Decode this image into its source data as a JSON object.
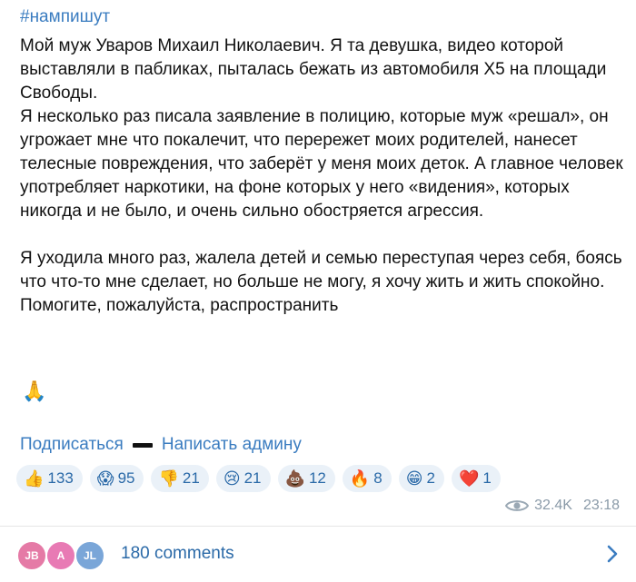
{
  "post": {
    "hashtag": "#нампишут",
    "paragraph1": "Мой муж Уваров Михаил Николаевич. Я та девушка, видео которой выставляли в пабликах, пыталась бежать из автомобиля Х5 на площади Свободы.",
    "paragraph2": "Я несколько раз писала заявление в полицию, которые муж «решал», он угрожает мне что покалечит, что перережет моих родителей, нанесет телесные повреждения, что заберёт у меня моих деток. А главное человек употребляет наркотики, на фоне которых у него «видения», которых никогда и не было, и очень сильно обостряется агрессия.",
    "paragraph3": "Я уходила много раз, жалела детей и семью переступая через себя, боясь что что-то мне сделает, но больше не могу, я хочу жить и жить спокойно. Помогите, пожалуйста, распространить",
    "pray_emoji": "🙏"
  },
  "links": {
    "subscribe": "Подписаться",
    "write_admin": "Написать админу"
  },
  "reactions": [
    {
      "emoji": "👍",
      "count": "133"
    },
    {
      "emoji": "😱",
      "count": "95"
    },
    {
      "emoji": "👎",
      "count": "21"
    },
    {
      "emoji": "😢",
      "count": "21"
    },
    {
      "emoji": "💩",
      "count": "12"
    },
    {
      "emoji": "🔥",
      "count": "8"
    },
    {
      "emoji": "😁",
      "count": "2"
    },
    {
      "emoji": "❤️",
      "count": "1"
    }
  ],
  "meta": {
    "views": "32.4K",
    "time": "23:18"
  },
  "comments": {
    "label": "180 comments",
    "avatars": [
      {
        "initials": "JB",
        "color": "#e57aa6"
      },
      {
        "initials": "A",
        "color": "#e87ab4"
      },
      {
        "initials": "JL",
        "color": "#7aa6d8"
      }
    ]
  },
  "colors": {
    "link": "#3a7cc0",
    "reaction_bg": "#eaf1f8"
  }
}
